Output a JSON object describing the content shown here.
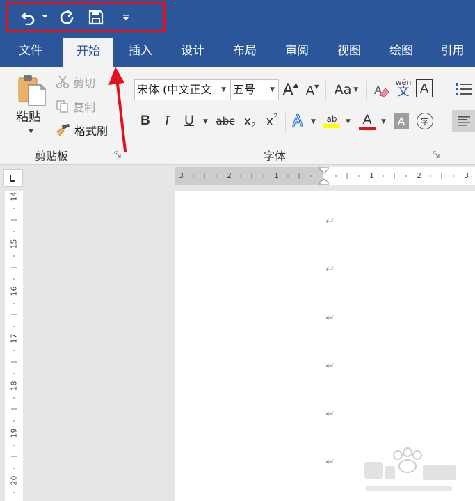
{
  "quick_access": {
    "undo_icon": "undo-icon",
    "redo_icon": "redo-icon",
    "save_icon": "save-icon",
    "customize_icon": "customize-caret-icon"
  },
  "tabs": [
    {
      "label": "文件"
    },
    {
      "label": "开始"
    },
    {
      "label": "插入"
    },
    {
      "label": "设计"
    },
    {
      "label": "布局"
    },
    {
      "label": "审阅"
    },
    {
      "label": "视图"
    },
    {
      "label": "绘图"
    },
    {
      "label": "引用"
    }
  ],
  "clipboard": {
    "paste_label": "粘贴",
    "cut_label": "剪切",
    "copy_label": "复制",
    "format_painter_label": "格式刷",
    "group_label": "剪贴板"
  },
  "font": {
    "font_name": "宋体 (中文正文",
    "font_size": "五号",
    "grow_label": "A",
    "shrink_label": "A",
    "change_case_label": "Aa",
    "phonetic_top": "wén",
    "phonetic_bottom": "文",
    "char_border_label": "A",
    "bold_label": "B",
    "italic_label": "I",
    "underline_label": "U",
    "strike_label": "abc",
    "subscript_base": "x",
    "subscript_mark": "2",
    "superscript_base": "x",
    "superscript_mark": "2",
    "text_effect_label": "A",
    "highlight_label": "ab",
    "font_color_label": "A",
    "shading_label": "A",
    "enclose_label": "字",
    "group_label": "字体"
  },
  "ruler_h": {
    "numbers": [
      "3",
      "2",
      "1",
      "1",
      "2",
      "3"
    ]
  },
  "ruler_v": {
    "numbers": [
      "14",
      "15",
      "16",
      "17",
      "18",
      "19",
      "20"
    ]
  },
  "paragraph_mark": "↵",
  "colors": {
    "accent": "#2b579a",
    "qat_highlight": "#e0141e",
    "arrow": "#e0141e",
    "highlight_yellow": "#ffff00",
    "font_red": "#e0141e"
  }
}
